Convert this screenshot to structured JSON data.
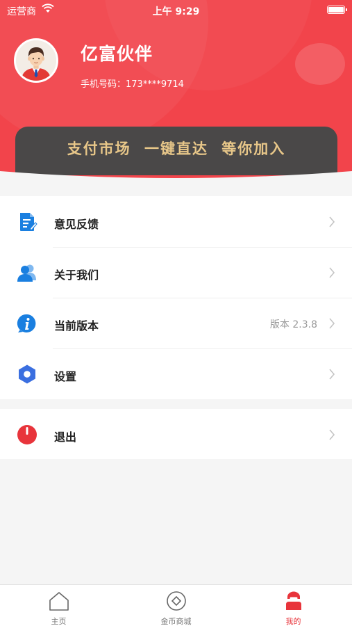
{
  "status_bar": {
    "carrier": "运营商",
    "time": "上午 9:29"
  },
  "profile": {
    "name": "亿富伙伴",
    "phone_label": "手机号码：",
    "phone_value": "173****9714"
  },
  "banner": {
    "text": "支付市场 一键直达 等你加入"
  },
  "menu": {
    "items": [
      {
        "label": "意见反馈",
        "icon": "feedback-icon",
        "value": ""
      },
      {
        "label": "关于我们",
        "icon": "users-icon",
        "value": ""
      },
      {
        "label": "当前版本",
        "icon": "info-icon",
        "value": "版本 2.3.8"
      },
      {
        "label": "设置",
        "icon": "settings-hexagon-icon",
        "value": ""
      }
    ],
    "logout": {
      "label": "退出",
      "icon": "power-icon"
    }
  },
  "tabbar": {
    "tabs": [
      {
        "label": "主页",
        "icon": "home-icon",
        "active": false
      },
      {
        "label": "金币商城",
        "icon": "coin-icon",
        "active": false
      },
      {
        "label": "我的",
        "icon": "profile-icon",
        "active": true
      }
    ]
  },
  "colors": {
    "header_red": "#f2444b",
    "banner_gold": "#e8c789",
    "banner_dark": "#4a4848",
    "icon_blue": "#1a7fe0",
    "logout_red": "#e8343b",
    "settings_blue": "#3b6fe0"
  }
}
